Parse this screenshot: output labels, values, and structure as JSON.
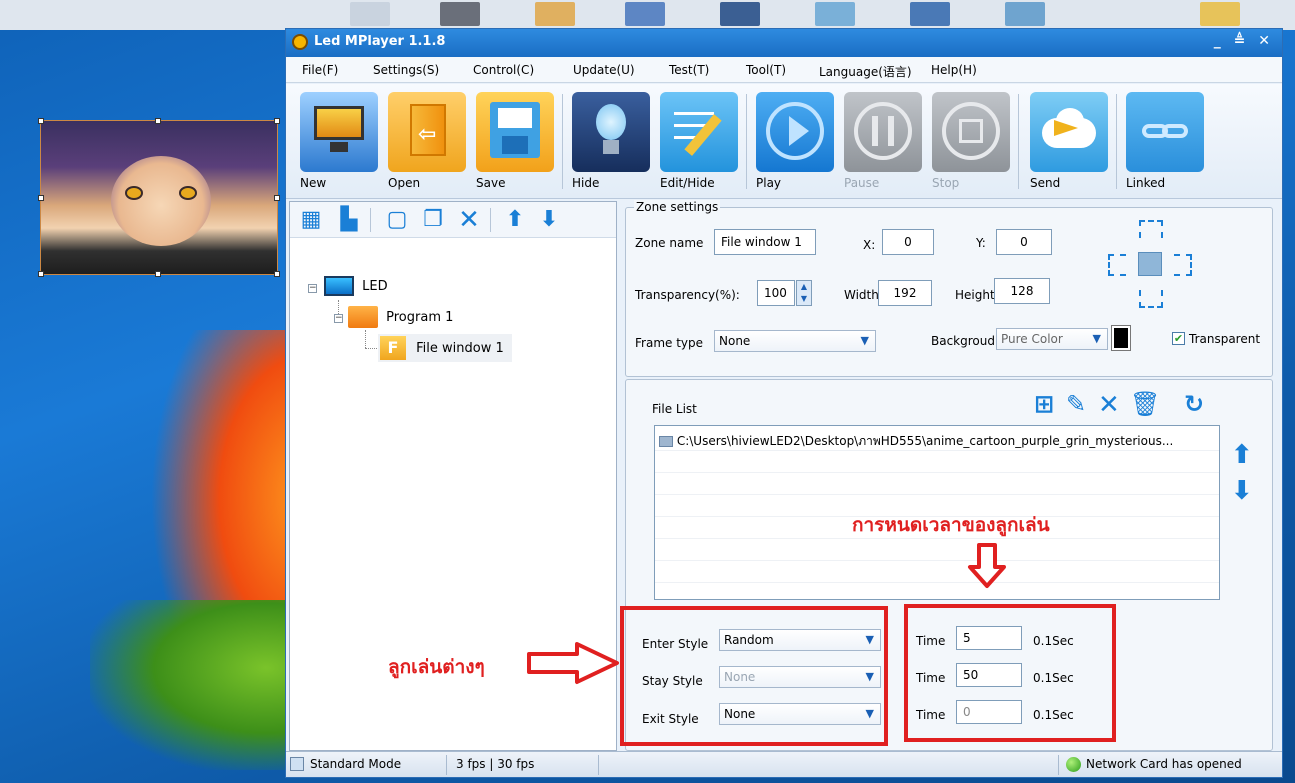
{
  "window": {
    "title": "Led MPlayer 1.1.8",
    "controls": "_ ≜ ✕"
  },
  "menu": [
    "File(F)",
    "Settings(S)",
    "Control(C)",
    "Update(U)",
    "Test(T)",
    "Tool(T)",
    "Language(语言)",
    "Help(H)"
  ],
  "toolbar": {
    "new": "New",
    "open": "Open",
    "save": "Save",
    "hide": "Hide",
    "edit_hide": "Edit/Hide",
    "play": "Play",
    "pause": "Pause",
    "stop": "Stop",
    "send": "Send",
    "linked": "Linked"
  },
  "tree": {
    "root": "LED",
    "program": "Program 1",
    "window": "File window 1"
  },
  "zone": {
    "group_title": "Zone settings",
    "name_label": "Zone name",
    "name_value": "File window 1",
    "x_label": "X:",
    "x_value": "0",
    "y_label": "Y:",
    "y_value": "0",
    "transparency_label": "Transparency(%):",
    "transparency_value": "100",
    "width_label": "Width",
    "width_value": "192",
    "height_label": "Height",
    "height_value": "128",
    "frame_label": "Frame type",
    "frame_value": "None",
    "background_label": "Backgroud",
    "background_value": "Pure Color",
    "transparent_label": "Transparent",
    "transparent_checked": true
  },
  "files": {
    "label": "File List",
    "items": [
      "C:\\Users\\hiviewLED2\\Desktop\\ภาพHD555\\anime_cartoon_purple_grin_mysterious..."
    ]
  },
  "styles": {
    "enter_label": "Enter Style",
    "enter_value": "Random",
    "stay_label": "Stay Style",
    "stay_value": "None",
    "exit_label": "Exit Style",
    "exit_value": "None"
  },
  "times": [
    {
      "label": "Time",
      "value": "5",
      "unit": "0.1Sec"
    },
    {
      "label": "Time",
      "value": "50",
      "unit": "0.1Sec"
    },
    {
      "label": "Time",
      "value": "0",
      "unit": "0.1Sec"
    }
  ],
  "annotations": {
    "time_note": "การหนดเวลาของลูกเล่น",
    "style_note": "ลูกเล่นต่างๆ"
  },
  "status": {
    "mode": "Standard Mode",
    "fps": "3 fps | 30 fps",
    "network": "Network Card has opened"
  },
  "colors": {
    "accent": "#1a7fd6",
    "annotation": "#e02020",
    "title_bar": "#1a6dc4"
  }
}
